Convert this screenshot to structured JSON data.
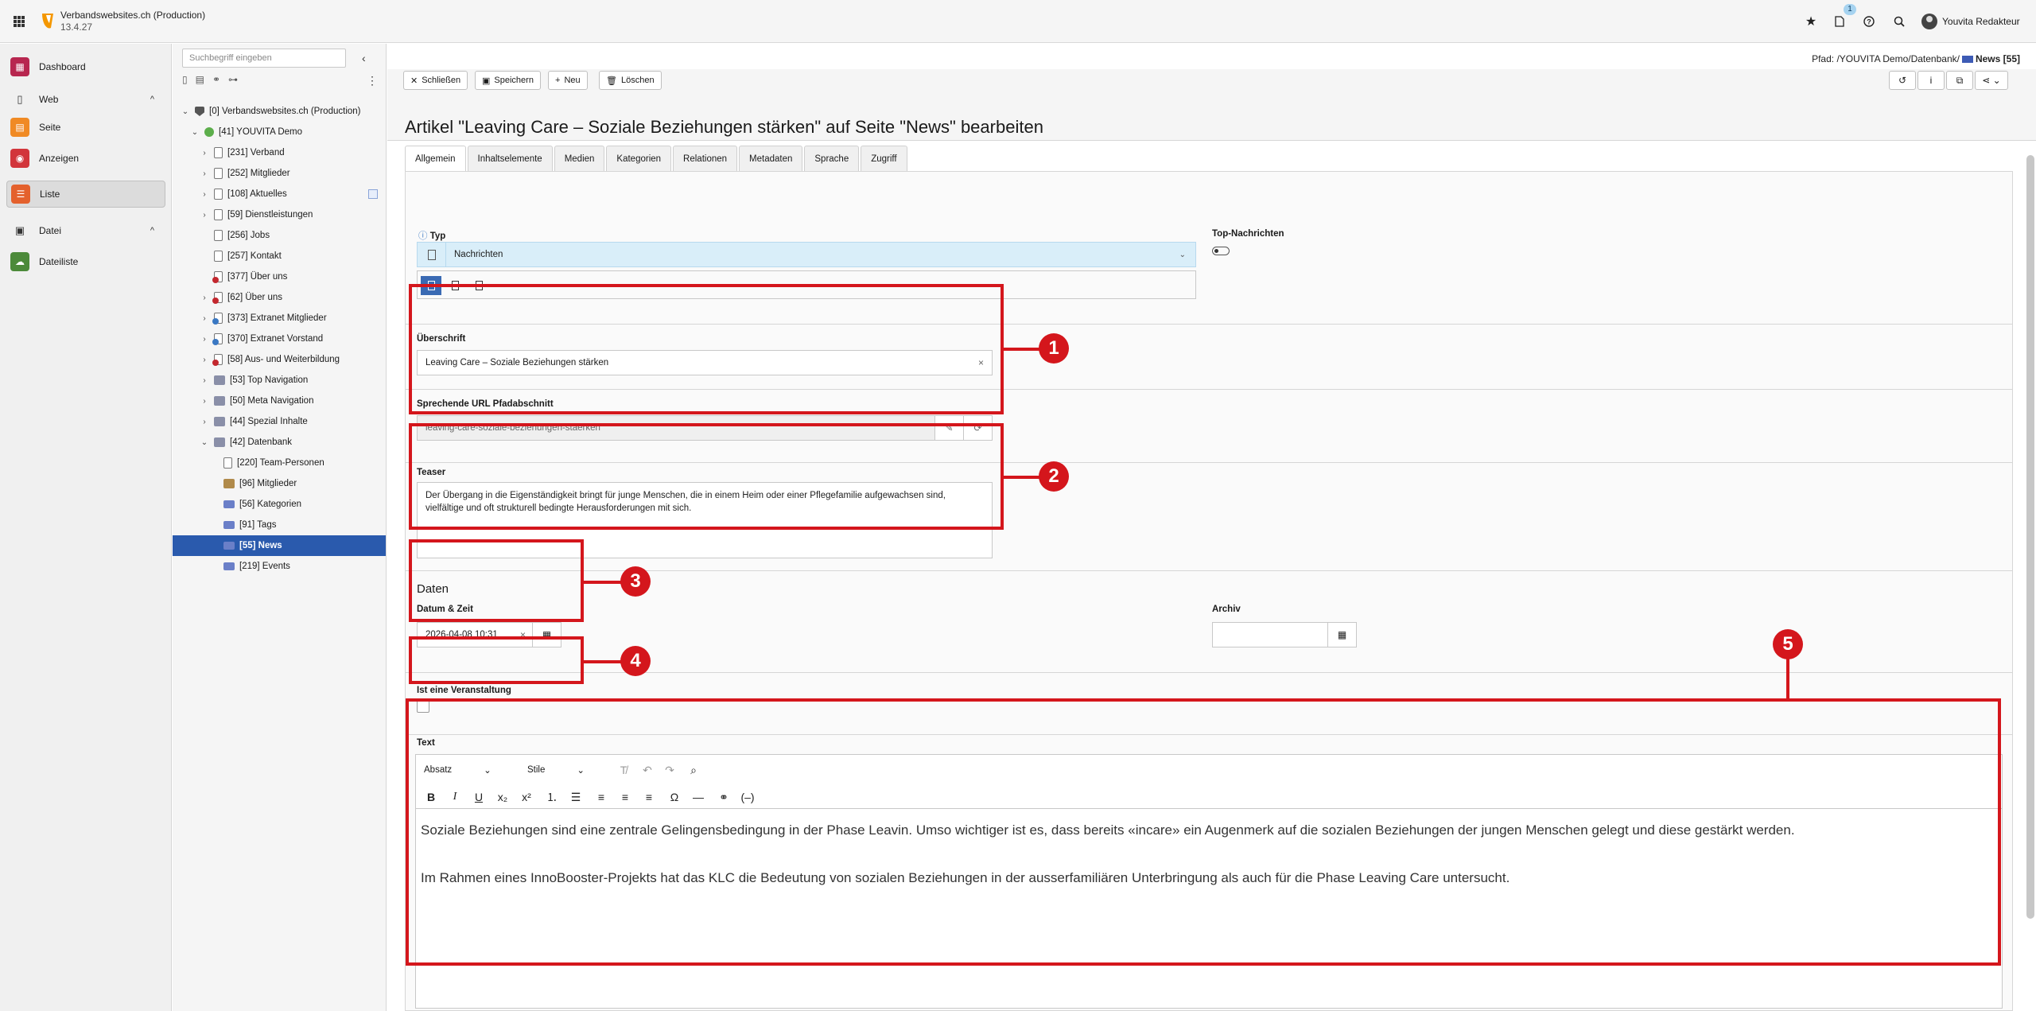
{
  "topbar": {
    "site_name": "Verbandswebsites.ch (Production)",
    "version": "13.4.27",
    "notification_count": "1",
    "user_name": "Youvita Redakteur"
  },
  "modules": {
    "dashboard": "Dashboard",
    "web_group": "Web",
    "seite": "Seite",
    "anzeigen": "Anzeigen",
    "liste": "Liste",
    "datei_group": "Datei",
    "dateiliste": "Dateiliste"
  },
  "tree": {
    "search_placeholder": "Suchbegriff eingeben",
    "nodes": [
      "[0] Verbandswebsites.ch (Production)",
      "[41] YOUVITA Demo",
      "[231] Verband",
      "[252] Mitglieder",
      "[108] Aktuelles",
      "[59] Dienstleistungen",
      "[256] Jobs",
      "[257] Kontakt",
      "[377] Über uns",
      "[62] Über uns",
      "[373] Extranet Mitglieder",
      "[370] Extranet Vorstand",
      "[58] Aus- und Weiterbildung",
      "[53] Top Navigation",
      "[50] Meta Navigation",
      "[44] Spezial Inhalte",
      "[42] Datenbank",
      "[220] Team-Personen",
      "[96] Mitglieder",
      "[56] Kategorien",
      "[91] Tags",
      "[55] News",
      "[219] Events"
    ]
  },
  "content": {
    "path_prefix": "Pfad: /YOUVITA Demo/Datenbank/",
    "path_current": "News [55]",
    "buttons": {
      "close": "Schließen",
      "save": "Speichern",
      "new": "Neu",
      "delete": "Löschen"
    },
    "title": "Artikel \"Leaving Care – Soziale Beziehungen stärken\" auf Seite \"News\" bearbeiten",
    "tabs": [
      "Allgemein",
      "Inhaltselemente",
      "Medien",
      "Kategorien",
      "Relationen",
      "Metadaten",
      "Sprache",
      "Zugriff"
    ],
    "form": {
      "typ_label": "Typ",
      "typ_value": "Nachrichten",
      "top_news_label": "Top-Nachrichten",
      "headline_label": "Überschrift",
      "headline_value": "Leaving Care – Soziale Beziehungen stärken",
      "slug_label": "Sprechende URL Pfadabschnitt",
      "slug_value": "leaving-care-soziale-beziehungen-staerken",
      "teaser_label": "Teaser",
      "teaser_value": "Der Übergang in die Eigenständigkeit bringt für junge Menschen, die in einem Heim oder einer Pflegefamilie aufgewachsen sind, vielfältige und oft strukturell bedingte Herausforderungen mit sich.",
      "dates_heading": "Daten",
      "datetime_label": "Datum & Zeit",
      "datetime_value": "2026-04-08 10:31",
      "archive_label": "Archiv",
      "event_label": "Ist eine Veranstaltung",
      "text_label": "Text",
      "rte_format": "Absatz",
      "rte_style": "Stile",
      "rte_paragraph_1": "Soziale Beziehungen sind eine zentrale Gelingensbedingung in der Phase Leavin. Umso wichtiger ist es, dass bereits «incare» ein Augenmerk auf die sozialen Beziehungen der jungen Menschen gelegt und diese gestärkt werden.",
      "rte_paragraph_2": "Im Rahmen eines InnoBooster-Projekts hat das KLC die Bedeutung von sozialen Beziehungen in der ausserfamiliären Unterbringung als auch für die Phase Leaving Care untersucht."
    }
  },
  "annotations": [
    "1",
    "2",
    "3",
    "4",
    "5"
  ],
  "colors": {
    "accent_red": "#d4161c",
    "selected_blue": "#2a5aad",
    "type_field": "#d9eef9"
  }
}
